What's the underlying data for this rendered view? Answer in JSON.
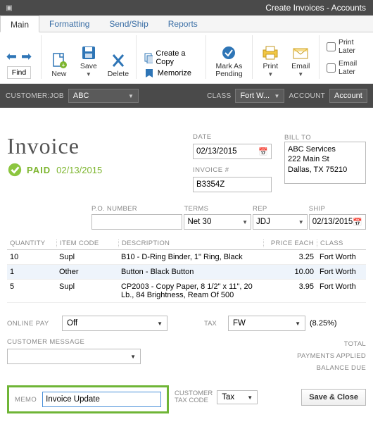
{
  "window": {
    "title": "Create Invoices - Accounts"
  },
  "tabs": [
    "Main",
    "Formatting",
    "Send/Ship",
    "Reports"
  ],
  "ribbon": {
    "find": "Find",
    "new": "New",
    "save": "Save",
    "delete": "Delete",
    "create_copy": "Create a Copy",
    "memorize": "Memorize",
    "mark_pending": "Mark As\nPending",
    "print": "Print",
    "email": "Email",
    "print_later": "Print Later",
    "email_later": "Email Later"
  },
  "darkbar": {
    "customer_label": "CUSTOMER:JOB",
    "customer_value": "ABC",
    "class_label": "CLASS",
    "class_value": "Fort W...",
    "account_label": "ACCOUNT",
    "account_value": "Account"
  },
  "invoice": {
    "title": "Invoice",
    "paid_label": "PAID",
    "paid_date": "02/13/2015",
    "date_label": "DATE",
    "date_value": "02/13/2015",
    "invno_label": "INVOICE #",
    "invno_value": "B3354Z",
    "billto_label": "BILL TO",
    "billto_lines": "ABC Services\n222 Main St\nDallas, TX 75210"
  },
  "sec": {
    "po_label": "P.O. NUMBER",
    "po_value": "",
    "terms_label": "TERMS",
    "terms_value": "Net 30",
    "rep_label": "REP",
    "rep_value": "JDJ",
    "ship_label": "SHIP",
    "ship_value": "02/13/2015"
  },
  "columns": {
    "qty": "QUANTITY",
    "item": "ITEM CODE",
    "desc": "DESCRIPTION",
    "price": "PRICE EACH",
    "class": "CLASS"
  },
  "rows": [
    {
      "qty": "10",
      "item": "Supl",
      "desc": "B10 - D-Ring Binder, 1\" Ring, Black",
      "price": "3.25",
      "class": "Fort Worth"
    },
    {
      "qty": "1",
      "item": "Other",
      "desc": "Button - Black Button",
      "price": "10.00",
      "class": "Fort Worth"
    },
    {
      "qty": "5",
      "item": "Supl",
      "desc": "CP2003 - Copy Paper, 8 1/2\" x 11\", 20 Lb., 84 Brightness, Ream Of 500",
      "price": "3.95",
      "class": "Fort Worth"
    }
  ],
  "lower": {
    "online_pay_label": "ONLINE PAY",
    "online_pay_value": "Off",
    "cust_msg_label": "CUSTOMER MESSAGE",
    "cust_msg_value": "",
    "tax_label": "TAX",
    "tax_value": "FW",
    "tax_pct": "(8.25%)",
    "totals": {
      "total": "TOTAL",
      "payments": "PAYMENTS APPLIED",
      "balance": "BALANCE DUE"
    }
  },
  "memo": {
    "label": "MEMO",
    "value": "Invoice Update"
  },
  "taxcode": {
    "label1": "CUSTOMER",
    "label2": "TAX CODE",
    "value": "Tax"
  },
  "save_close": "Save & Close"
}
